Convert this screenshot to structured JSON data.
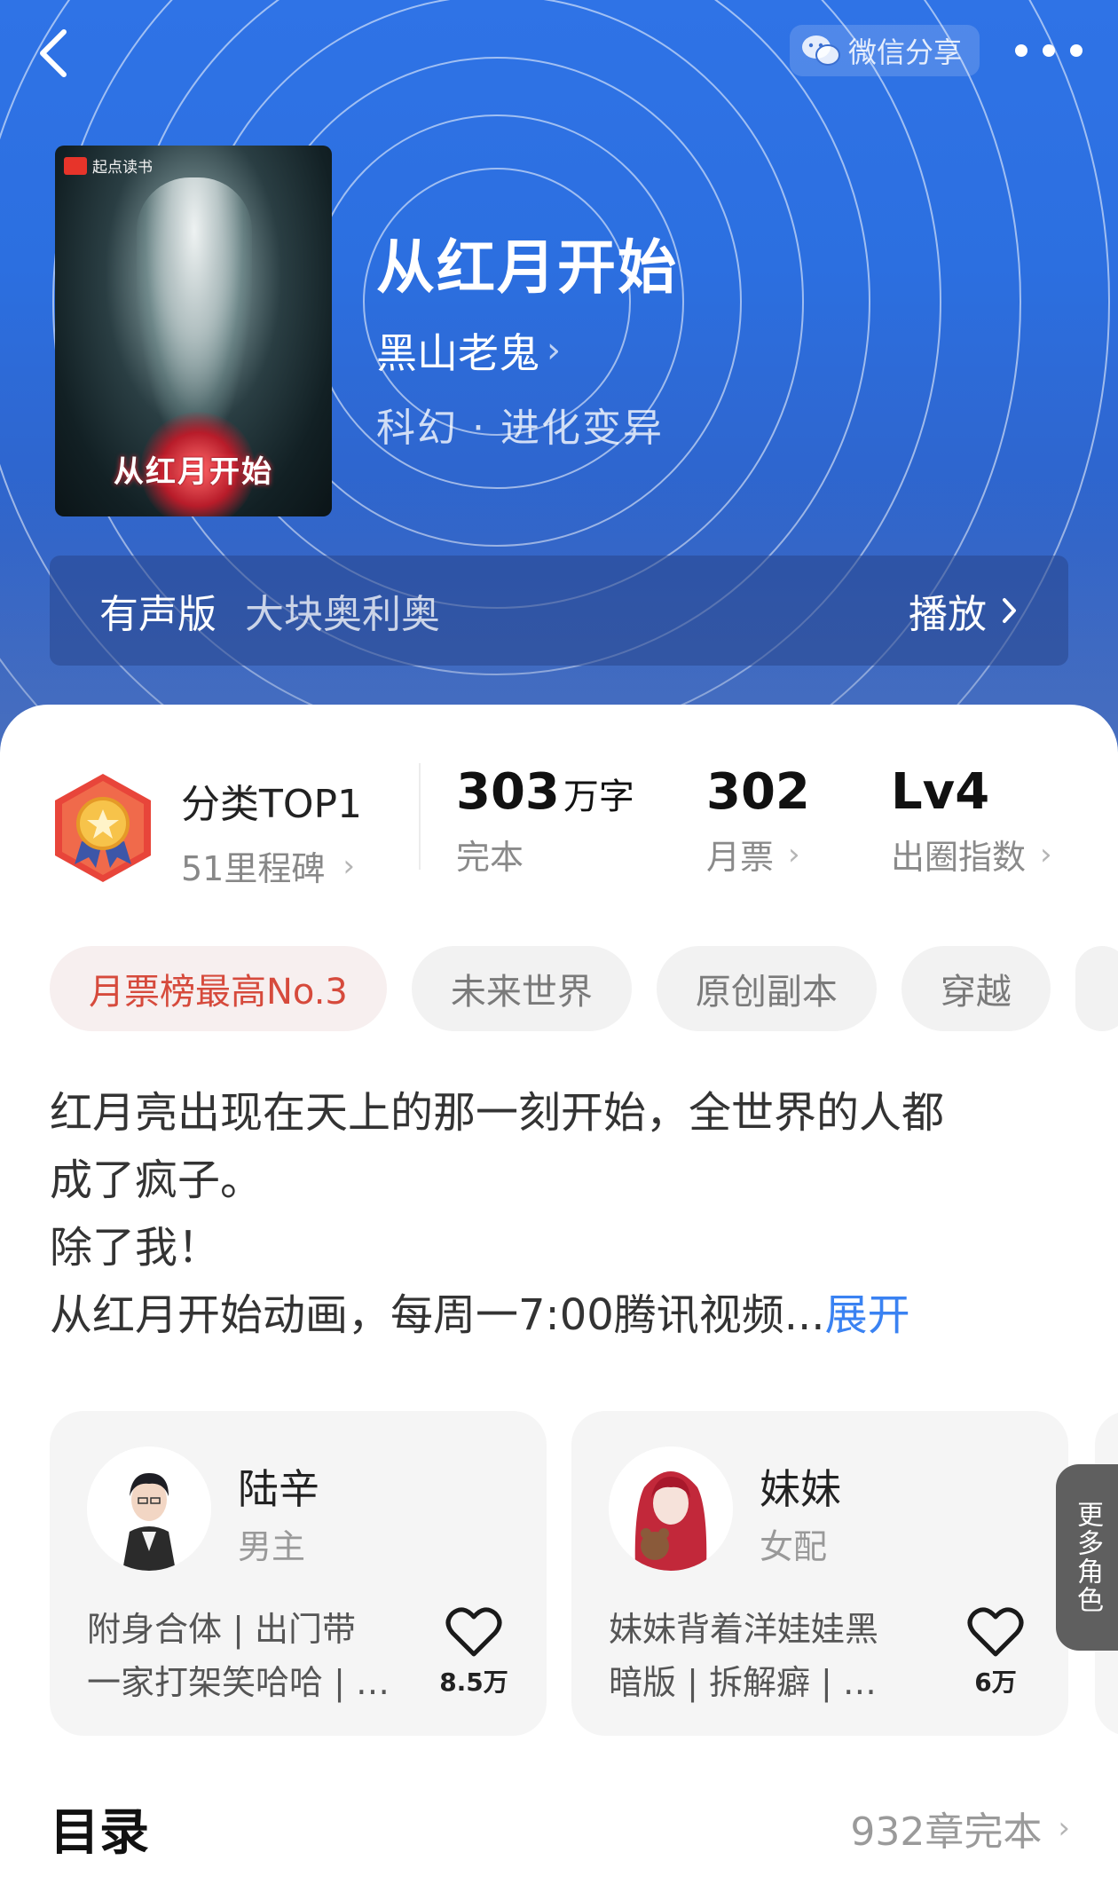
{
  "header": {
    "share_label": "微信分享",
    "icons": [
      "back-icon",
      "wechat-icon",
      "more-icon"
    ]
  },
  "book": {
    "cover_publisher": "起点读书",
    "cover_title": "从红月开始",
    "title": "从红月开始",
    "author": "黑山老鬼",
    "genre": "科幻 · 进化变异"
  },
  "audio": {
    "label": "有声版",
    "narrator": "大块奥利奥",
    "play_label": "播放"
  },
  "stats": {
    "rank_title": "分类TOP1",
    "rank_sub": "51里程碑",
    "words_value": "303",
    "words_unit": "万字",
    "words_caption": "完本",
    "tickets_value": "302",
    "tickets_caption": "月票",
    "level_value": "Lv4",
    "level_caption": "出圈指数"
  },
  "tags": [
    "月票榜最高No.3",
    "未来世界",
    "原创副本",
    "穿越"
  ],
  "synopsis": {
    "lines": [
      "红月亮出现在天上的那一刻开始，全世界的人都",
      "成了疯子。",
      "除了我！",
      "从红月开始动画，每周一7:00腾讯视频..."
    ],
    "expand_label": "展开"
  },
  "characters": [
    {
      "name": "陆辛",
      "role": "男主",
      "desc_line1": "附身合体 | 出门带",
      "desc_line2": "一家打架笑哈哈 | …",
      "likes": "8.5万"
    },
    {
      "name": "妹妹",
      "role": "女配",
      "desc_line1": "妹妹背着洋娃娃黑",
      "desc_line2": "暗版 | 拆解癖 | …",
      "likes": "6万"
    }
  ],
  "more_roles_label": "更多角色",
  "toc": {
    "title": "目录",
    "status": "932章完本"
  },
  "colors": {
    "hero_blue": "#2f73e6",
    "accent_red": "#d64a3c",
    "link_blue": "#3a82f2",
    "card_bg": "#f5f5f5"
  }
}
